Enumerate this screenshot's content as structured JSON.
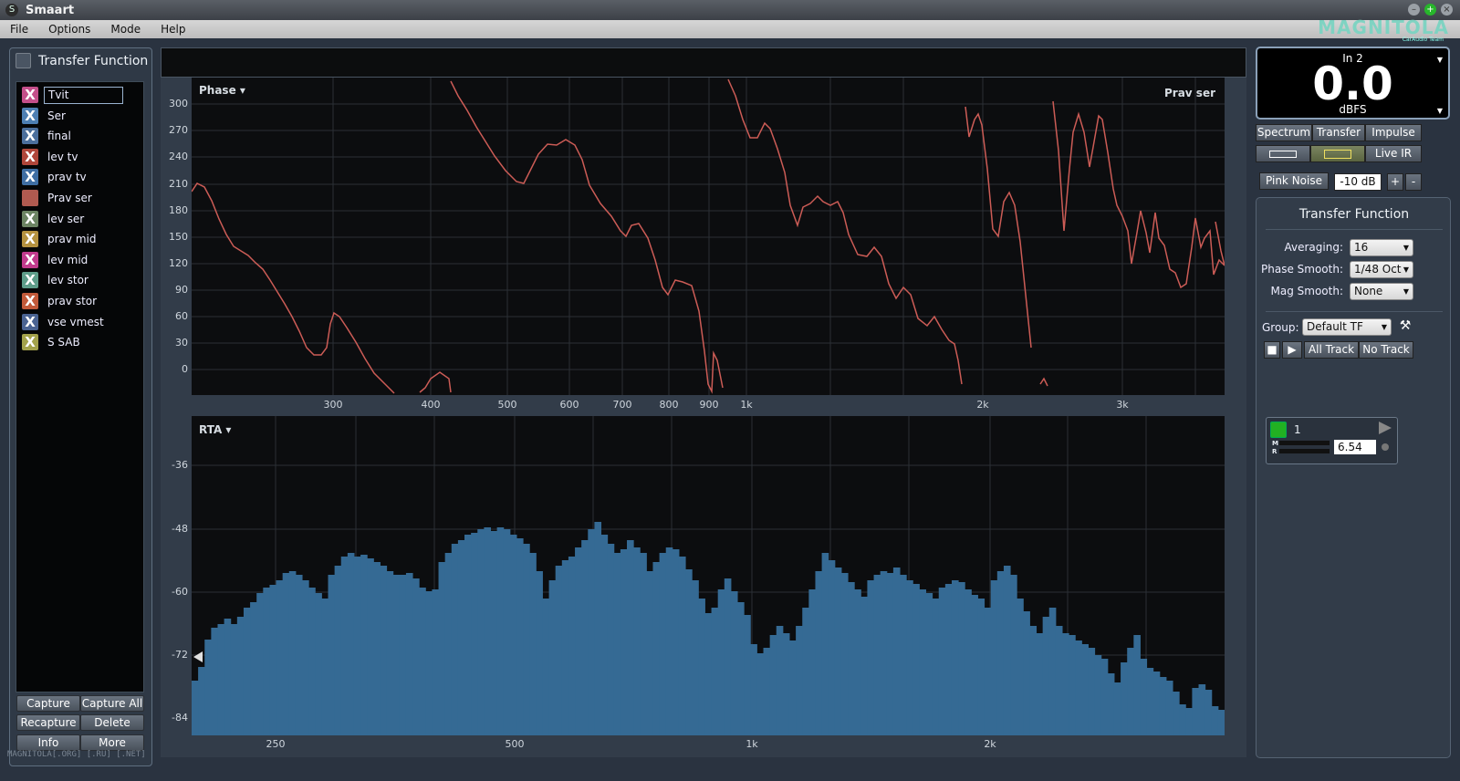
{
  "window": {
    "title": "Smaart",
    "logo": "MAGNITOLA",
    "logo_sub": "CarAudio Team"
  },
  "menu": [
    "File",
    "Options",
    "Mode",
    "Help"
  ],
  "left": {
    "header": "Transfer Function",
    "traces": [
      {
        "label": "Tvit",
        "color": "#c44f8a",
        "editing": true
      },
      {
        "label": "Ser",
        "color": "#4d7fb3"
      },
      {
        "label": "final",
        "color": "#4b6f9c"
      },
      {
        "label": "lev tv",
        "color": "#b0463a"
      },
      {
        "label": "prav tv",
        "color": "#3f6ea3"
      },
      {
        "label": "Prav ser",
        "color": "#b05a50",
        "solid": true
      },
      {
        "label": "lev ser",
        "color": "#6c8463"
      },
      {
        "label": "prav mid",
        "color": "#b59240"
      },
      {
        "label": "lev mid",
        "color": "#c13b8d"
      },
      {
        "label": "lev stor",
        "color": "#5e9d8a"
      },
      {
        "label": "prav stor",
        "color": "#c25a3a"
      },
      {
        "label": "vse vmest",
        "color": "#4a6392"
      },
      {
        "label": "S SAB",
        "color": "#a3a24b"
      }
    ],
    "buttons": {
      "capture": "Capture",
      "capture_all": "Capture All",
      "recapture": "Recapture",
      "delete": "Delete",
      "info": "Info",
      "more": "More"
    },
    "watermark": "MAGNITOLA[.ORG] [.RU] [.NET]"
  },
  "phase_plot": {
    "menu_label": "Phase ▾",
    "trace_label": "Prav ser",
    "y_ticks": [
      "300",
      "270",
      "240",
      "210",
      "180",
      "150",
      "120",
      "90",
      "60",
      "30",
      "0"
    ],
    "x_ticks": [
      "300",
      "400",
      "500",
      "600",
      "700",
      "800",
      "900",
      "1k",
      "2k",
      "3k"
    ]
  },
  "rta_plot": {
    "menu_label": "RTA ▾",
    "y_ticks": [
      "-36",
      "-48",
      "-60",
      "-72",
      "-84"
    ],
    "x_ticks": [
      "250",
      "500",
      "1k",
      "2k"
    ]
  },
  "right": {
    "meter": {
      "channel": "In 2",
      "value": "0.0",
      "unit": "dBFS"
    },
    "mode_buttons": {
      "spectrum": "Spectrum",
      "transfer": "Transfer",
      "impulse": "Impulse",
      "live_ir": "Live IR"
    },
    "generator": {
      "label": "Pink Noise",
      "level": "-10 dB",
      "plus": "+",
      "minus": "-"
    },
    "tf": {
      "title": "Transfer Function",
      "averaging_label": "Averaging:",
      "averaging": "16",
      "phase_smooth_label": "Phase Smooth:",
      "phase_smooth": "1/48 Oct",
      "mag_smooth_label": "Mag Smooth:",
      "mag_smooth": "None",
      "group_label": "Group:",
      "group": "Default TF",
      "all_track": "All Track",
      "no_track": "No Track",
      "track": {
        "name": "1",
        "m": "M",
        "r": "R",
        "delay": "6.54"
      }
    }
  }
}
